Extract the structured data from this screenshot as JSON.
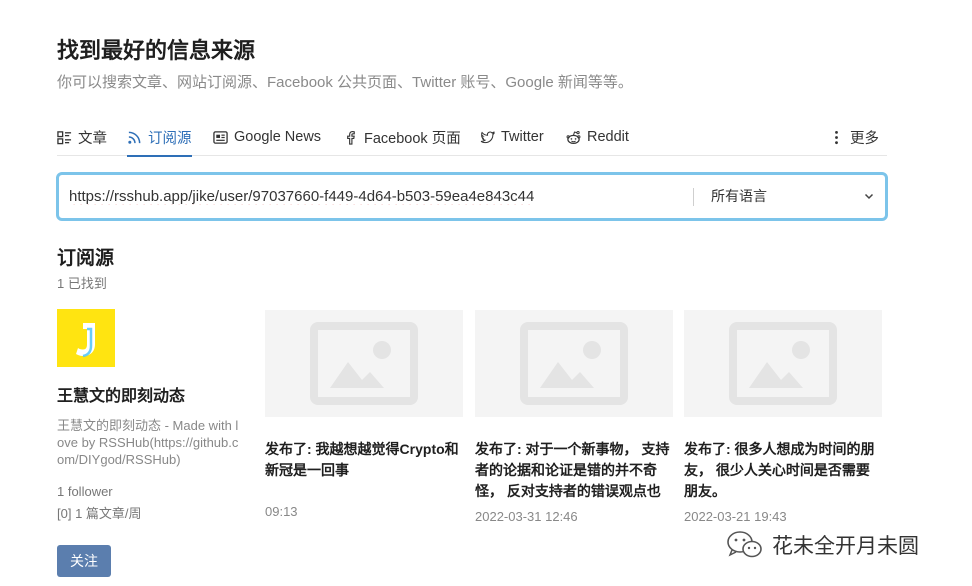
{
  "header": {
    "title": "找到最好的信息来源",
    "subtitle": "你可以搜索文章、网站订阅源、Facebook 公共页面、Twitter 账号、Google 新闻等等。"
  },
  "tabs": [
    {
      "label": "文章",
      "icon": "article-icon"
    },
    {
      "label": "订阅源",
      "icon": "rss-icon",
      "active": true
    },
    {
      "label": "Google News",
      "icon": "news-icon"
    },
    {
      "label": "Facebook 页面",
      "icon": "facebook-icon"
    },
    {
      "label": "Twitter",
      "icon": "twitter-icon"
    },
    {
      "label": "Reddit",
      "icon": "reddit-icon"
    }
  ],
  "more_label": "更多",
  "search": {
    "value": "https://rsshub.app/jike/user/97037660-f449-4d64-b503-59ea4e843c44",
    "language": "所有语言"
  },
  "results": {
    "title": "订阅源",
    "count_text": "1 已找到"
  },
  "feed": {
    "name": "王慧文的即刻动态",
    "description": "王慧文的即刻动态 - Made with love by RSSHub(https://github.com/DIYgod/RSSHub)",
    "followers": "1 follower",
    "rate": "[0] 1 篇文章/周",
    "follow_label": "关注",
    "avatar_color": "#ffe411"
  },
  "cards": [
    {
      "title": "发布了: 我越想越觉得Crypto和新冠是一回事",
      "time": "09:13"
    },
    {
      "title": "发布了: 对于一个新事物， 支持者的论据和论证是错的并不奇怪， 反对支持者的错误观点也很正常",
      "time": "2022-03-31 12:46"
    },
    {
      "title": "发布了: 很多人想成为时间的朋友， 很少人关心时间是否需要朋友。",
      "time": "2022-03-21 19:43"
    }
  ],
  "watermark": {
    "text": "花未全开月未圆"
  },
  "colors": {
    "accent": "#2e6fb7",
    "focus_border": "#7cc4ea",
    "button": "#5b7eae"
  }
}
